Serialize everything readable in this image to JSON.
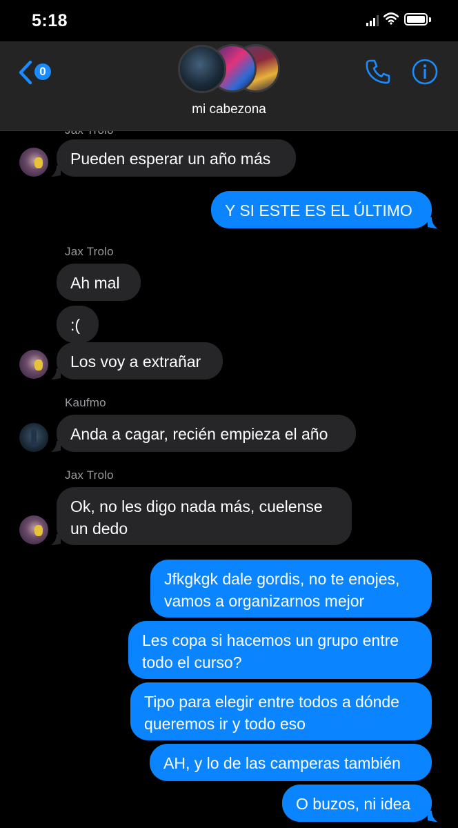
{
  "status": {
    "time": "5:18"
  },
  "header": {
    "back_badge": "0",
    "group_name": "mi cabezona"
  },
  "messages": {
    "partial_sender": "Jax Trolo",
    "m1": "Pueden esperar un año más",
    "m2": "Y SI ESTE ES EL ÚLTIMO",
    "sender_jax": "Jax Trolo",
    "m3": "Ah mal",
    "m4": ":(",
    "m5": "Los voy a extrañar",
    "sender_kaufmo": "Kaufmo",
    "m6": "Anda a cagar, recién empieza el año",
    "sender_jax2": "Jax Trolo",
    "m7_l1": "Ok, no les digo nada más, cuelense",
    "m7_l2": "un dedo",
    "m8_l1": "Jfkgkgk dale gordis, no te enojes,",
    "m8_l2": "vamos a organizarnos mejor",
    "m9_l1": "Les copa si hacemos un grupo entre",
    "m9_l2": "todo el curso?",
    "m10_l1": "Tipo para elegir entre todos a dónde",
    "m10_l2": "queremos ir y todo eso",
    "m11": "AH, y lo de las camperas también",
    "m12": "O buzos, ni idea"
  },
  "colors": {
    "background": "#000000",
    "header": "#242424",
    "incoming_bubble": "#262629",
    "outgoing_bubble": "#0a84ff",
    "accent": "#1a8cff",
    "sender_label": "#9a9a9f"
  },
  "icons": [
    "signal-icon",
    "wifi-icon",
    "battery-icon",
    "back-chevron-icon",
    "phone-icon",
    "info-icon"
  ]
}
